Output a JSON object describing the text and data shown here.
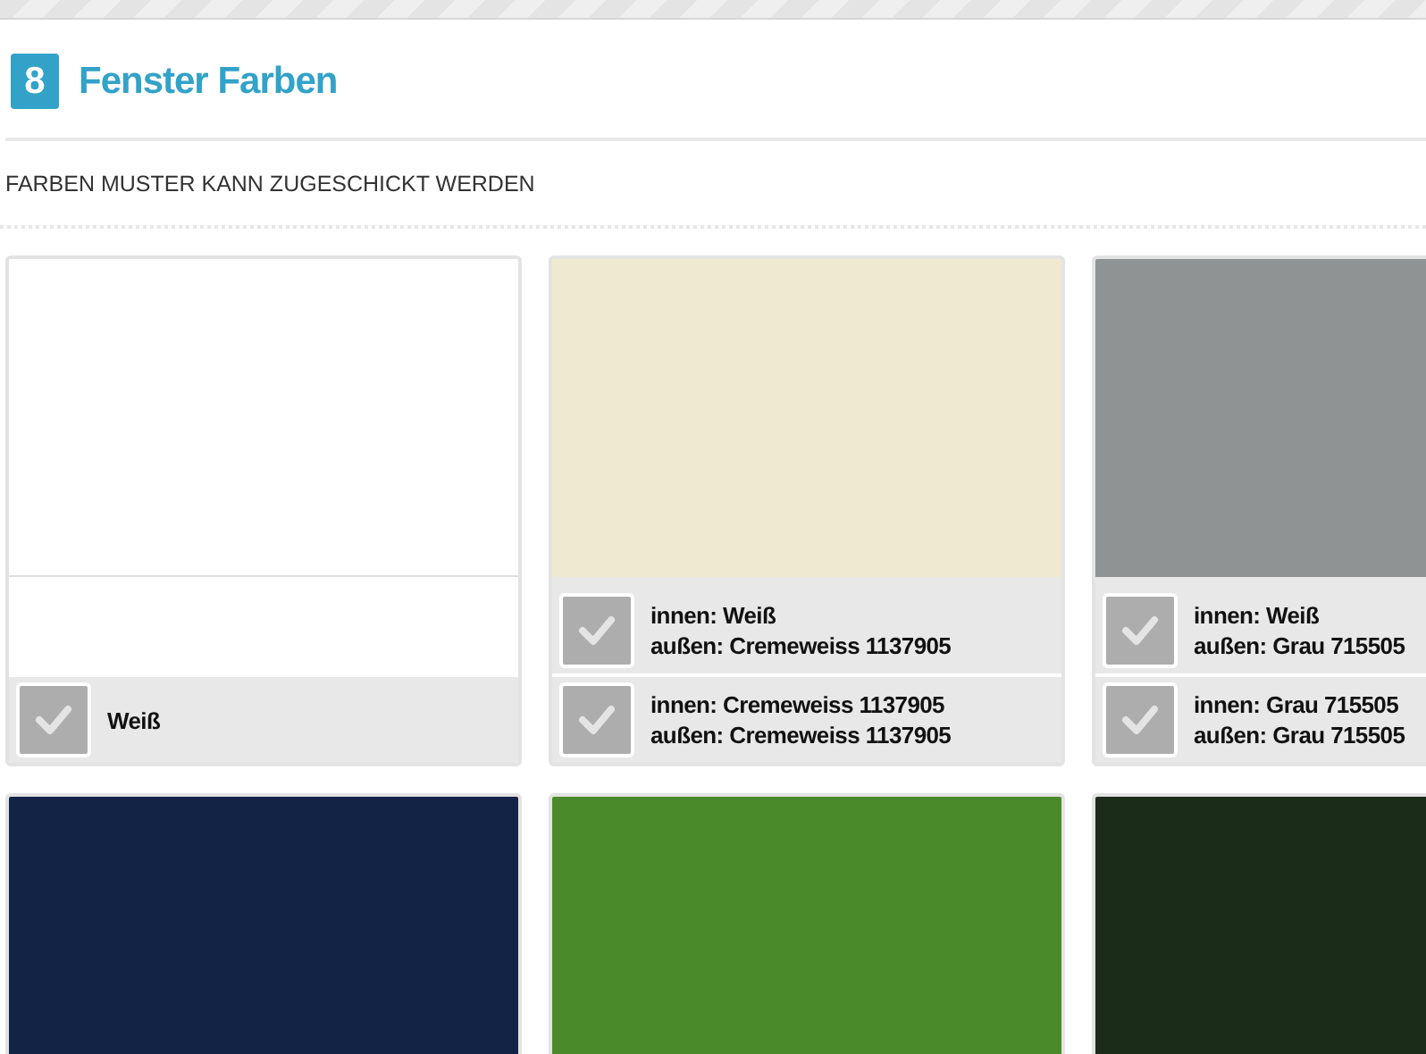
{
  "section": {
    "number": "8",
    "title": "Fenster Farben",
    "note": "FARBEN MUSTER KANN ZUGESCHICKT WERDEN"
  },
  "colors": [
    {
      "color": "#ffffff",
      "options": [
        {
          "lines": [
            "Weiß"
          ],
          "selected": false
        }
      ]
    },
    {
      "color": "#efe9cf",
      "options": [
        {
          "lines": [
            "innen: Weiß",
            "außen: Cremeweiss 1137905"
          ],
          "selected": false
        },
        {
          "lines": [
            "innen: Cremeweiss 1137905",
            "außen: Cremeweiss 1137905"
          ],
          "selected": false
        }
      ]
    },
    {
      "color": "#8f9394",
      "options": [
        {
          "lines": [
            "innen: Weiß",
            "außen: Grau 715505"
          ],
          "selected": false
        },
        {
          "lines": [
            "innen: Grau 715505",
            "außen: Grau 715505"
          ],
          "selected": false
        }
      ]
    },
    {
      "color": "#132346"
    },
    {
      "color": "#4b8a2a"
    },
    {
      "color": "#1b2d18"
    }
  ]
}
